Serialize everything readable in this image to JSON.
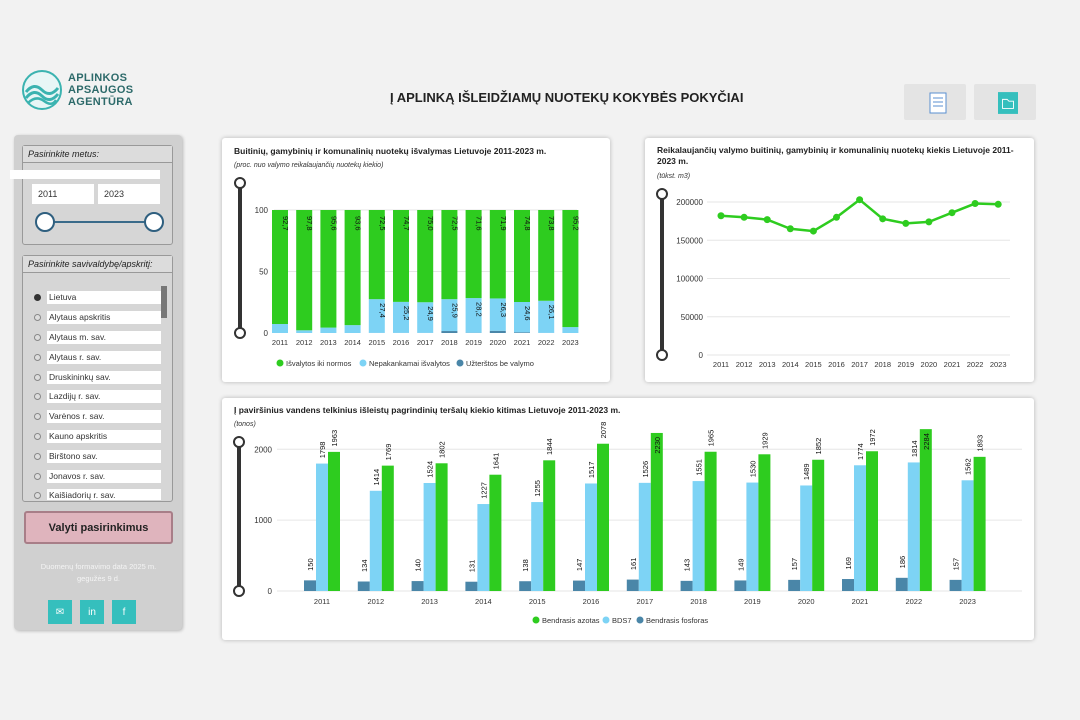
{
  "logo": {
    "line1": "APLINKOS",
    "line2": "APSAUGOS",
    "line3": "AGENTŪRA"
  },
  "page_title": "Į APLINKĄ IŠLEIDŽIAMŲ NUOTEKŲ KOKYBĖS POKYČIAI",
  "toolbar": {
    "icons": [
      "document-icon",
      "folder-icon"
    ]
  },
  "sidebar": {
    "year_label": "Pasirinkite metus:",
    "year_from": "2011",
    "year_to": "2023",
    "muni_label": "Pasirinkite savivaldybę/apskritį:",
    "items": [
      "Lietuva",
      "Alytaus apskritis",
      "Alytaus m. sav.",
      "Alytaus r. sav.",
      "Druskininkų sav.",
      "Lazdijų r. sav.",
      "Varėnos r. sav.",
      "Kauno apskritis",
      "Birštono sav.",
      "Jonavos r. sav.",
      "Kaišiadorių r. sav."
    ],
    "selected": 0,
    "reset_label": "Valyti pasirinkimus",
    "date_line1": "Duomenų formavimo data 2025 m.",
    "date_line2": "gegužės 9 d.",
    "social": [
      "mail-icon",
      "linkedin-icon",
      "facebook-icon"
    ]
  },
  "colors": {
    "green": "#2ecc1f",
    "lightblue": "#7dd3f5",
    "steel": "#4a86a8",
    "slider": "#333333"
  },
  "chart_data": [
    {
      "type": "bar",
      "title": "Buitinių, gamybinių ir komunalinių nuotekų išvalymas Lietuvoje 2011-2023 m.",
      "subtitle": "(proc. nuo valymo reikalaujančių nuotekų kiekio)",
      "categories": [
        "2011",
        "2012",
        "2013",
        "2014",
        "2015",
        "2016",
        "2017",
        "2018",
        "2019",
        "2020",
        "2021",
        "2022",
        "2023"
      ],
      "yticks": [
        0,
        50,
        100
      ],
      "ylim": [
        0,
        100
      ],
      "stacked": true,
      "series": [
        {
          "name": "Išvalytos iki normos",
          "values": [
            92.7,
            97.8,
            95.6,
            93.6,
            72.5,
            74.7,
            75.0,
            72.5,
            71.6,
            71.9,
            74.8,
            73.8,
            95.2
          ]
        },
        {
          "name": "Nepakankamai išvalytos",
          "values": [
            7.3,
            2.2,
            4.4,
            6.4,
            27.4,
            25.2,
            24.9,
            25.9,
            28.2,
            26.3,
            24.6,
            26.1,
            4.8
          ]
        },
        {
          "name": "Užterštos be valymo",
          "values": [
            0,
            0,
            0,
            0,
            0.1,
            0.1,
            0.1,
            1.6,
            0.2,
            1.8,
            0.6,
            0.1,
            0
          ]
        }
      ],
      "labels_green": [
        "92,7",
        "97,8",
        "95,6",
        "93,6",
        "72,5",
        "74,7",
        "75,0",
        "72,5",
        "71,6",
        "71,9",
        "74,8",
        "73,8",
        "95,2"
      ],
      "labels_blue": [
        "",
        "",
        "",
        "",
        "27,4",
        "25,2",
        "24,9",
        "25,9",
        "28,2",
        "26,3",
        "24,6",
        "26,1",
        ""
      ]
    },
    {
      "type": "line",
      "title": "Reikalaujančių valymo buitinių, gamybinių ir komunalinių nuotekų kiekis Lietuvoje 2011-2023 m.",
      "subtitle": "(tūkst. m3)",
      "x": [
        "2011",
        "2012",
        "2013",
        "2014",
        "2015",
        "2016",
        "2017",
        "2018",
        "2019",
        "2020",
        "2021",
        "2022",
        "2023"
      ],
      "yticks": [
        0,
        50000,
        100000,
        150000,
        200000
      ],
      "ylim": [
        0,
        200000
      ],
      "series": [
        {
          "values": [
            182000,
            180000,
            177000,
            165000,
            162000,
            180000,
            203000,
            178000,
            172000,
            174000,
            186000,
            198000,
            197000
          ]
        }
      ]
    },
    {
      "type": "bar",
      "title": "Į paviršinius vandens telkinius išleistų pagrindinių teršalų kiekio kitimas Lietuvoje 2011-2023 m.",
      "subtitle": "(tonos)",
      "categories": [
        "2011",
        "2012",
        "2013",
        "2014",
        "2015",
        "2016",
        "2017",
        "2018",
        "2019",
        "2020",
        "2021",
        "2022",
        "2023"
      ],
      "yticks": [
        0,
        1000,
        2000
      ],
      "ylim": [
        0,
        2300
      ],
      "series": [
        {
          "name": "Bendrasis fosforas",
          "values": [
            150,
            134,
            140,
            131,
            138,
            147,
            161,
            143,
            149,
            157,
            169,
            186,
            157
          ]
        },
        {
          "name": "BDS7",
          "values": [
            1798,
            1414,
            1524,
            1227,
            1255,
            1517,
            1526,
            1551,
            1530,
            1489,
            1774,
            1814,
            1562
          ]
        },
        {
          "name": "Bendrasis azotas",
          "values": [
            1963,
            1769,
            1802,
            1641,
            1844,
            2078,
            2230,
            1965,
            1929,
            1852,
            1972,
            2284,
            1893
          ]
        }
      ],
      "legend": [
        "Bendrasis azotas",
        "BDS7",
        "Bendrasis fosforas"
      ]
    }
  ]
}
